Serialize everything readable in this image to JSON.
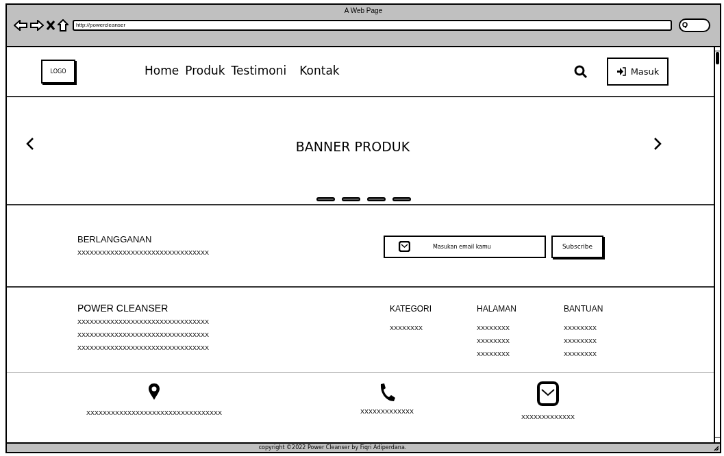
{
  "browser": {
    "title": "A Web Page",
    "url": "http://powercleanser"
  },
  "header": {
    "logo": "LOGO",
    "nav": [
      "Home",
      "Produk",
      "Testimoni",
      "Kontak"
    ],
    "login_button": "Masuk"
  },
  "banner": {
    "title": "BANNER PRODUK"
  },
  "subscribe": {
    "title": "BERLANGGANAN",
    "text": "XXXXXXXXXXXXXXXXXXXXXXXXXXXXXXXX",
    "email_placeholder": "Masukan email kamu",
    "button": "Subscribe"
  },
  "footer": {
    "brand": "POWER CLEANSER",
    "lines": [
      "XXXXXXXXXXXXXXXXXXXXXXXXXXXXXXXX",
      "XXXXXXXXXXXXXXXXXXXXXXXXXXXXXXXX",
      "XXXXXXXXXXXXXXXXXXXXXXXXXXXXXXXX"
    ],
    "columns": [
      {
        "title": "KATEGORI",
        "items": [
          "XXXXXXXX"
        ]
      },
      {
        "title": "HALAMAN",
        "items": [
          "XXXXXXXX",
          "XXXXXXXX",
          "XXXXXXXX"
        ]
      },
      {
        "title": "BANTUAN",
        "items": [
          "XXXXXXXX",
          "XXXXXXXX",
          "XXXXXXXX"
        ]
      }
    ]
  },
  "contacts": [
    {
      "kind": "location",
      "text": "XXXXXXXXXXXXXXXXXXXXXXXXXXXXXXXXX"
    },
    {
      "kind": "phone",
      "text": "XXXXXXXXXXXXX"
    },
    {
      "kind": "email",
      "text": "XXXXXXXXXXXXX"
    }
  ],
  "status_bar": "copyright ©2022 Power Cleanser by Fiqri Adiperdana."
}
